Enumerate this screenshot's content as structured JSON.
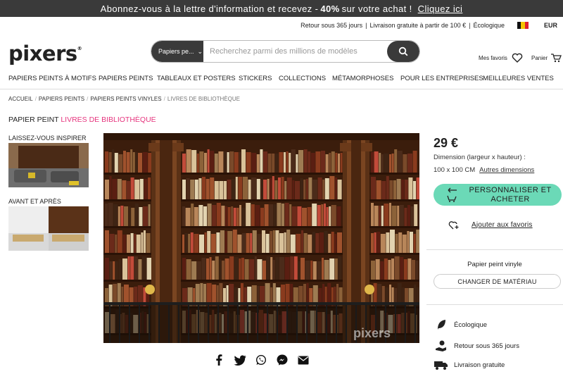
{
  "promo": {
    "text_before": "Abonnez-vous à la lettre d'information et recevez -",
    "discount": "40%",
    "text_after": "sur votre achat !",
    "link": "Cliquez ici"
  },
  "infobar": {
    "returns": "Retour sous 365 jours",
    "separator": "|",
    "delivery": "Livraison gratuite à partir de 100 €",
    "separator2": "|",
    "eco": "Écologique",
    "currency": "EUR"
  },
  "header": {
    "logo": "pixers",
    "logo_mark": "®",
    "search_category": "Papiers pe...",
    "search_placeholder": "Recherchez parmi des millions de modèles",
    "favorites": "Mes favoris",
    "cart": "Panier"
  },
  "nav": [
    "PAPIERS PEINTS À MOTIFS",
    "PAPIERS PEINTS",
    "TABLEAUX ET POSTERS",
    "STICKERS",
    "COLLECTIONS",
    "MÉTAMORPHOSES",
    "POUR LES ENTREPRISES",
    "MEILLEURES VENTES"
  ],
  "breadcrumb": [
    "ACCUEIL",
    "PAPIERS PEINTS",
    "PAPIERS PEINTS VINYLES",
    "LIVRES DE BIBLIOTHÈQUE"
  ],
  "breadcrumb_sep": "/",
  "title": {
    "prefix": "PAPIER PEINT",
    "highlight": "LIVRES DE BIBLIOTHÈQUE"
  },
  "side": {
    "inspire": "LAISSEZ-VOUS INSPIRER",
    "before_after": "AVANT ET APRÈS"
  },
  "image": {
    "watermark": "pixers"
  },
  "product": {
    "price": "29 €",
    "dimension_label": "Dimension (largeur x hauteur) :",
    "dimension_value": "100 x 100 CM",
    "other_dimensions": "Autres dimensions",
    "cta": "PERSONNALISER ET ACHETER",
    "add_favorites": "Ajouter aux favoris",
    "material": "Papier peint vinyle",
    "change_material": "CHANGER DE MATÉRIAU",
    "features": [
      "Écologique",
      "Retour sous 365 jours",
      "Livraison gratuite"
    ]
  },
  "colors": {
    "accent_pink": "#e6357e",
    "cta_green": "#6bd9b7",
    "dark": "#3a3a3a"
  }
}
